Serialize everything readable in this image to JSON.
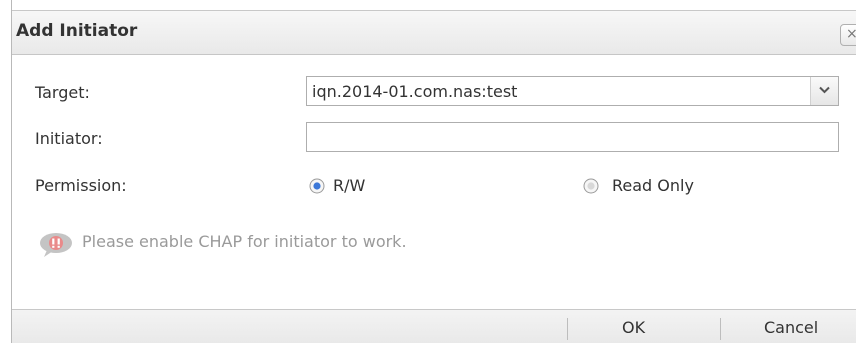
{
  "dialog": {
    "title": "Add Initiator",
    "close_label": "×"
  },
  "form": {
    "target": {
      "label": "Target:",
      "value": "iqn.2014-01.com.nas:test"
    },
    "initiator": {
      "label": "Initiator:",
      "value": "",
      "placeholder": ""
    },
    "permission": {
      "label": "Permission:",
      "options": [
        {
          "label": "R/W",
          "selected": true
        },
        {
          "label": "Read Only",
          "selected": false
        }
      ]
    }
  },
  "notice": {
    "text": "Please enable CHAP for initiator to work."
  },
  "footer": {
    "ok_label": "OK",
    "cancel_label": "Cancel"
  },
  "colors": {
    "notice_icon": "#b9b9b9",
    "radio_selected": "#3c78d8"
  }
}
